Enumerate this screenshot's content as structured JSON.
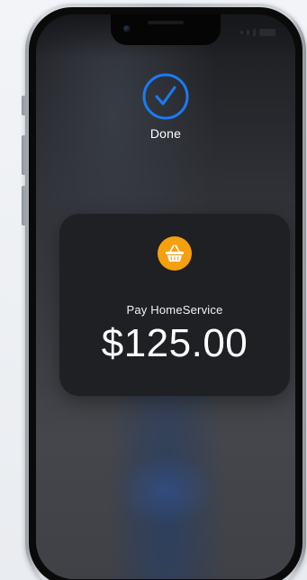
{
  "status": {
    "label": "Done",
    "icon": "checkmark-circle-icon",
    "ring_color": "#1a7cf3"
  },
  "card": {
    "merchant_icon": "shopping-basket-icon",
    "merchant_icon_color": "#f5a00f",
    "pay_label": "Pay HomeService",
    "amount": "$125.00"
  }
}
